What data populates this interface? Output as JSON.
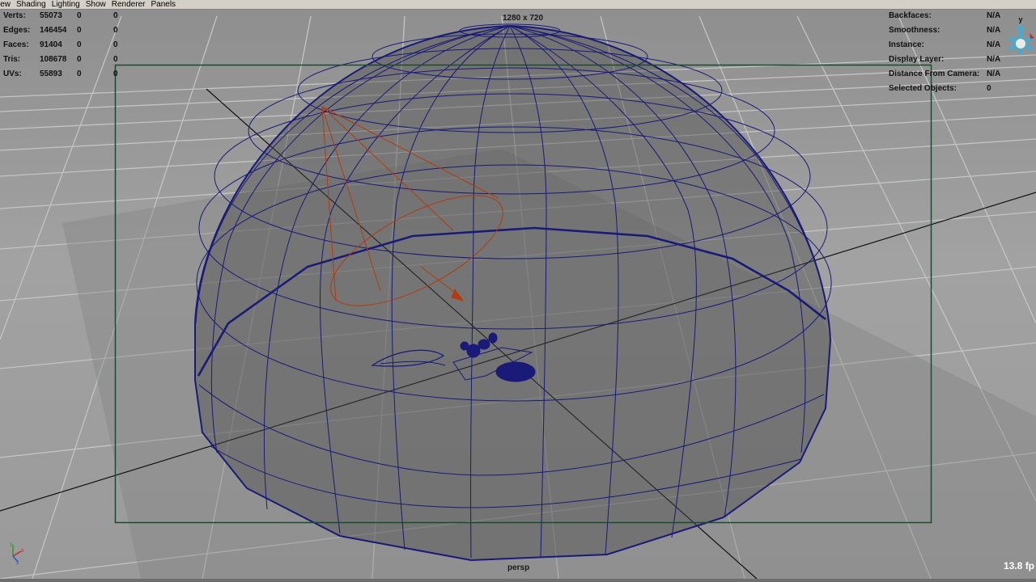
{
  "menu": [
    "iew",
    "Shading",
    "Lighting",
    "Show",
    "Renderer",
    "Panels"
  ],
  "stats": [
    {
      "label": "Verts:",
      "v1": "55073",
      "v2": "0",
      "v3": "0"
    },
    {
      "label": "Edges:",
      "v1": "146454",
      "v2": "0",
      "v3": "0"
    },
    {
      "label": "Faces:",
      "v1": "91404",
      "v2": "0",
      "v3": "0"
    },
    {
      "label": "Tris:",
      "v1": "108678",
      "v2": "0",
      "v3": "0"
    },
    {
      "label": "UVs:",
      "v1": "55893",
      "v2": "0",
      "v3": "0"
    }
  ],
  "object_info": [
    {
      "label": "Backfaces:",
      "value": "N/A"
    },
    {
      "label": "Smoothness:",
      "value": "N/A"
    },
    {
      "label": "Instance:",
      "value": "N/A"
    },
    {
      "label": "Display Layer:",
      "value": "N/A"
    },
    {
      "label": "Distance From Camera:",
      "value": "N/A"
    },
    {
      "label": "Selected Objects:",
      "value": "0"
    }
  ],
  "resolution_label": "1280 x 720",
  "camera_label": "persp",
  "fps_label": "13.8 fp",
  "view_cube_axis": "y",
  "small_axis": {
    "x": "x",
    "y": "y",
    "z": "z"
  },
  "colors": {
    "viewport_bg": "#a0a0a0",
    "grid": "#c2c2c2",
    "wireframe": "#1a1a78",
    "light": "#b03c10",
    "resolution_gate": "#1c4a2c"
  }
}
